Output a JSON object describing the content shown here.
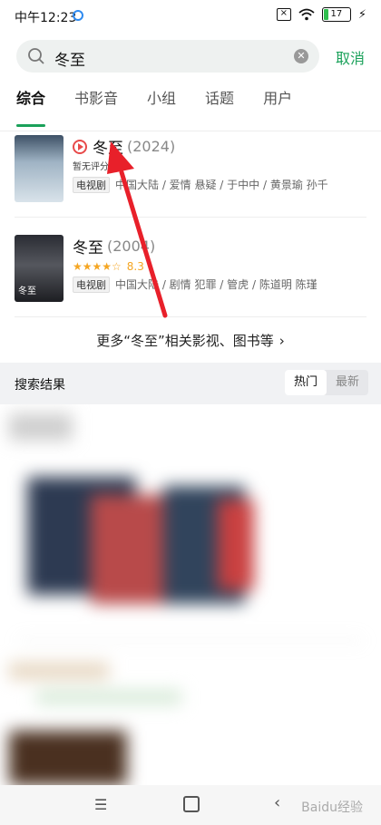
{
  "status": {
    "time": "中午12:23",
    "sim": "×",
    "battery": "17",
    "charging": "⚡"
  },
  "search": {
    "query": "冬至",
    "cancel": "取消"
  },
  "tabs": [
    "综合",
    "书影音",
    "小组",
    "话题",
    "用户"
  ],
  "movies": [
    {
      "title": "冬至",
      "year": "(2024)",
      "rating_text": "暂无评分",
      "type": "电视剧",
      "meta": "中国大陆 / 爱情 悬疑 / 于中中 / 黄景瑜 孙千"
    },
    {
      "title": "冬至",
      "year": "(2004)",
      "stars": "★★★★☆",
      "score": "8.3",
      "type": "电视剧",
      "meta": "中国大陆 / 剧情 犯罪 / 管虎 / 陈道明 陈瑾",
      "poster_caption": "冬至"
    }
  ],
  "more_link": "更多“冬至”相关影视、图书等",
  "results": {
    "title": "搜索结果",
    "hot": "热门",
    "newest": "最新"
  },
  "watermark": "Baidu经验",
  "colors": {
    "accent": "#1aa15a",
    "play": "#e84a4a",
    "star": "#f5a623",
    "arrow": "#e8202a"
  }
}
